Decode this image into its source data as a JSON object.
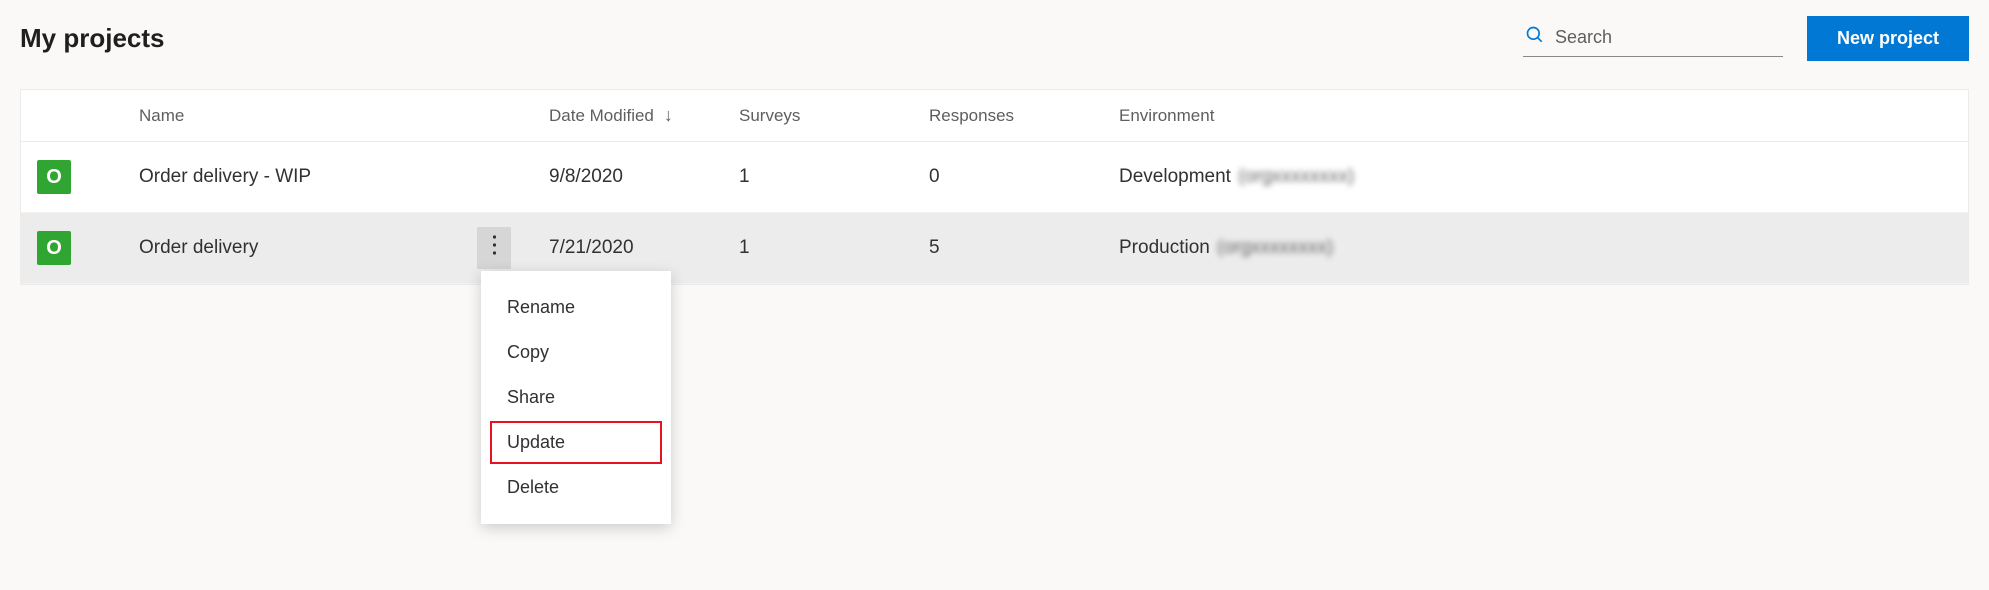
{
  "header": {
    "title": "My projects",
    "search_placeholder": "Search",
    "new_project_label": "New project"
  },
  "table": {
    "columns": {
      "name": "Name",
      "date_modified": "Date Modified",
      "surveys": "Surveys",
      "responses": "Responses",
      "environment": "Environment"
    },
    "rows": [
      {
        "icon_letter": "O",
        "name": "Order delivery - WIP",
        "date_modified": "9/8/2020",
        "surveys": "1",
        "responses": "0",
        "environment_name": "Development",
        "environment_org": "(orgxxxxxxxx)"
      },
      {
        "icon_letter": "O",
        "name": "Order delivery",
        "date_modified": "7/21/2020",
        "surveys": "1",
        "responses": "5",
        "environment_name": "Production",
        "environment_org": "(orgxxxxxxxx)"
      }
    ]
  },
  "context_menu": {
    "items": [
      {
        "label": "Rename",
        "highlighted": false
      },
      {
        "label": "Copy",
        "highlighted": false
      },
      {
        "label": "Share",
        "highlighted": false
      },
      {
        "label": "Update",
        "highlighted": true
      },
      {
        "label": "Delete",
        "highlighted": false
      }
    ]
  }
}
